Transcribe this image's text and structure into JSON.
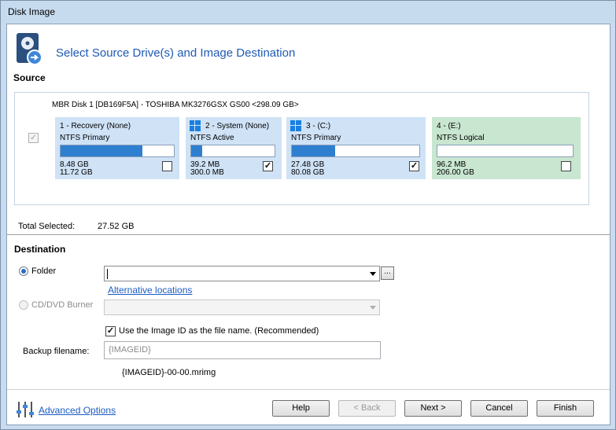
{
  "window": {
    "title": "Disk Image"
  },
  "header": {
    "title": "Select Source Drive(s) and Image Destination",
    "icon": "disk-image-icon"
  },
  "source": {
    "label": "Source",
    "disk_title": "MBR Disk 1 [DB169F5A] - TOSHIBA  MK3276GSX      GS00  <298.09 GB>",
    "disk_checked": true,
    "partitions": [
      {
        "name": "1 - Recovery (None)",
        "fs": "NTFS Primary",
        "used": "8.48 GB",
        "total": "11.72 GB",
        "fill": 0.72,
        "checked": false,
        "windows_logo": false,
        "color": "#cfe2f6"
      },
      {
        "name": "2 - System (None)",
        "fs": "NTFS Active",
        "used": "39.2 MB",
        "total": "300.0 MB",
        "fill": 0.13,
        "checked": true,
        "windows_logo": true,
        "color": "#cfe2f6"
      },
      {
        "name": "3 -  (C:)",
        "fs": "NTFS Primary",
        "used": "27.48 GB",
        "total": "80.08 GB",
        "fill": 0.34,
        "checked": true,
        "windows_logo": true,
        "color": "#cfe2f6"
      },
      {
        "name": "4 -  (E:)",
        "fs": "NTFS Logical",
        "used": "96.2 MB",
        "total": "206.00 GB",
        "fill": 0.0,
        "checked": false,
        "windows_logo": false,
        "color": "#c8e6d0"
      }
    ],
    "total_label": "Total Selected:",
    "total_value": "27.52 GB"
  },
  "destination": {
    "label": "Destination",
    "folder_label": "Folder",
    "folder_selected": true,
    "folder_value": "",
    "browse_label": "...",
    "alt_locations": "Alternative locations",
    "cd_label": "CD/DVD Burner",
    "cd_selected": false,
    "use_image_id_label": "Use the Image ID as the file name.  (Recommended)",
    "use_image_id_checked": true,
    "backup_filename_label": "Backup filename:",
    "backup_filename_placeholder": "{IMAGEID}",
    "filename_preview": "{IMAGEID}-00-00.mrimg"
  },
  "footer": {
    "advanced_options": "Advanced Options",
    "buttons": {
      "help": "Help",
      "back": "< Back",
      "next": "Next >",
      "cancel": "Cancel",
      "finish": "Finish"
    }
  },
  "colors": {
    "accent": "#1e5ab4",
    "bar_fill": "#2f7fd0",
    "link": "#1c5cc4"
  }
}
